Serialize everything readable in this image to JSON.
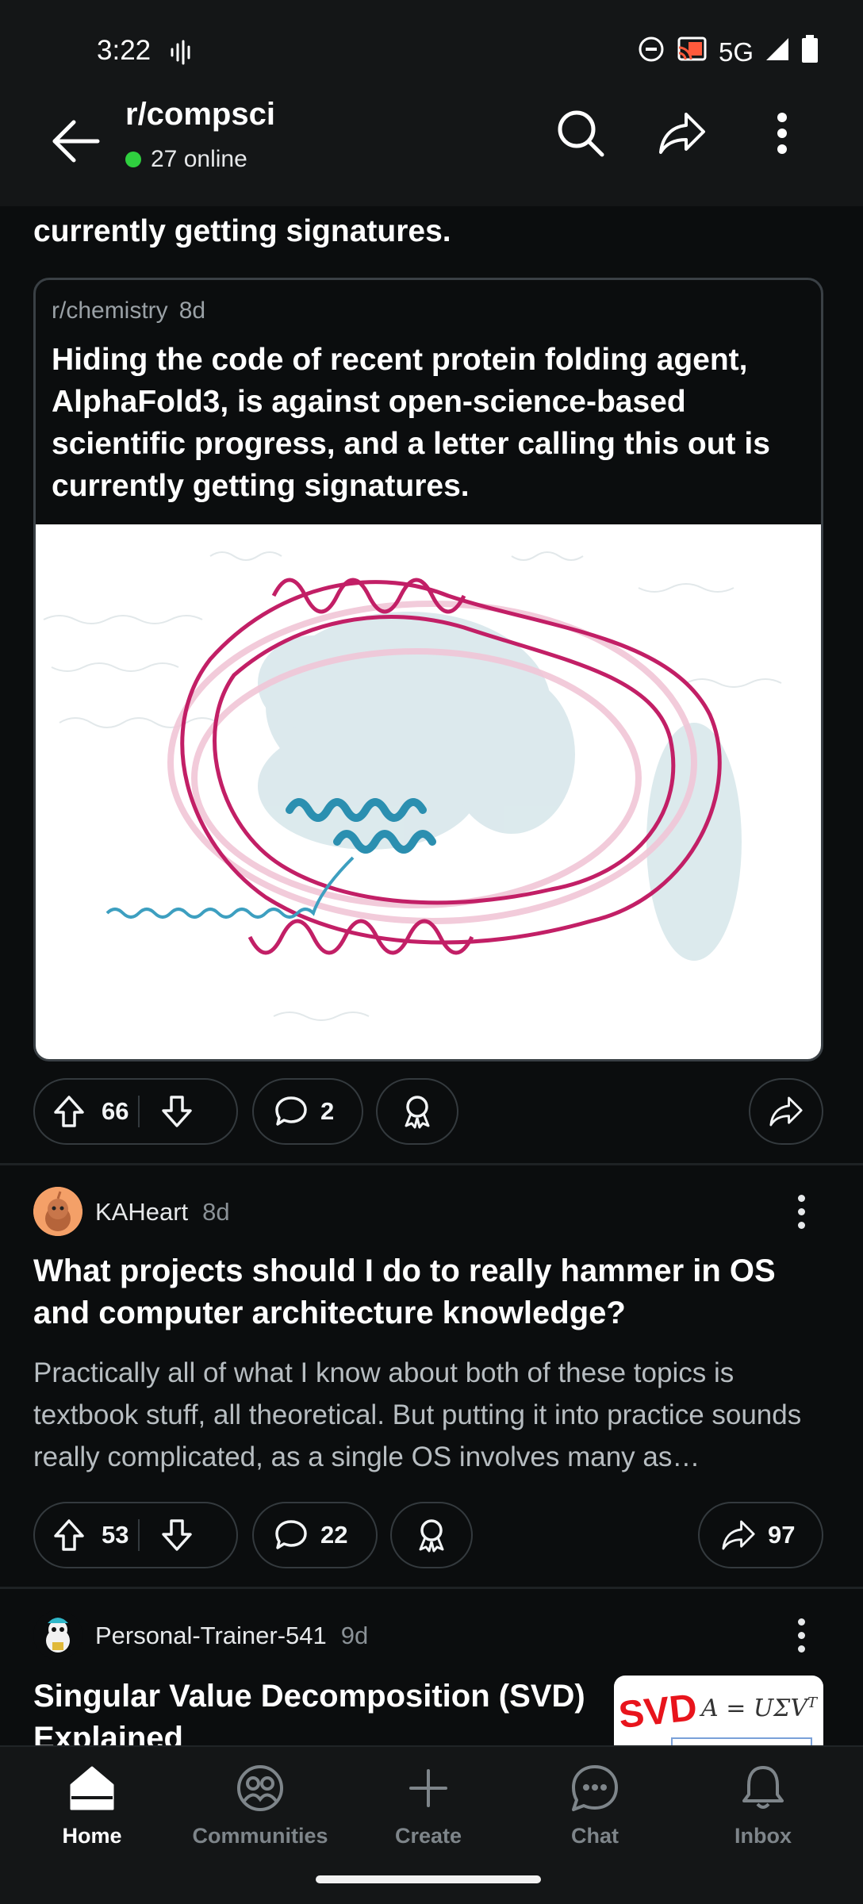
{
  "status_bar": {
    "time": "3:22",
    "network": "5G",
    "icons": [
      "voicemail-icon",
      "dnd-icon",
      "cast-icon",
      "signal-icon",
      "battery-icon"
    ]
  },
  "header": {
    "subreddit": "r/compsci",
    "online": "27 online",
    "online_color": "#2fcf3f",
    "icons": [
      "back-arrow-icon",
      "search-icon",
      "share-icon",
      "kebab-menu-icon"
    ]
  },
  "crosspost": {
    "prev_title_tail": "currently getting signatures.",
    "source_sub": "r/chemistry",
    "source_age": "8d",
    "title": "Hiding the code of recent protein folding agent, AlphaFold3, is against open-science-based scientific progress, and a letter calling this out is currently getting signatures.",
    "votes": "66",
    "comments": "2"
  },
  "posts": [
    {
      "author": "KAHeart",
      "age": "8d",
      "title": "What projects should I do to really hammer in OS and computer architecture knowledge?",
      "body": "Practically all of what I know about both of these topics is textbook stuff, all theoretical. But putting it into practice sounds really complicated, as a single OS involves many as…",
      "votes": "53",
      "comments": "22",
      "shares": "97"
    },
    {
      "author": "Personal-Trainer-541",
      "age": "9d",
      "title": "Singular Value Decomposition (SVD) Explained",
      "thumb_label": "SVD",
      "thumb_formula": "A = UΣV",
      "thumb_formula_sup": "T"
    }
  ],
  "bottom_nav": [
    {
      "label": "Home",
      "icon": "home-icon",
      "active": true
    },
    {
      "label": "Communities",
      "icon": "communities-icon",
      "active": false
    },
    {
      "label": "Create",
      "icon": "plus-icon",
      "active": false
    },
    {
      "label": "Chat",
      "icon": "chat-icon",
      "active": false
    },
    {
      "label": "Inbox",
      "icon": "bell-icon",
      "active": false
    }
  ],
  "colors": {
    "background": "#0b0d0e",
    "upvote_accent": "#ff4500",
    "svd_red": "#e8141c"
  }
}
